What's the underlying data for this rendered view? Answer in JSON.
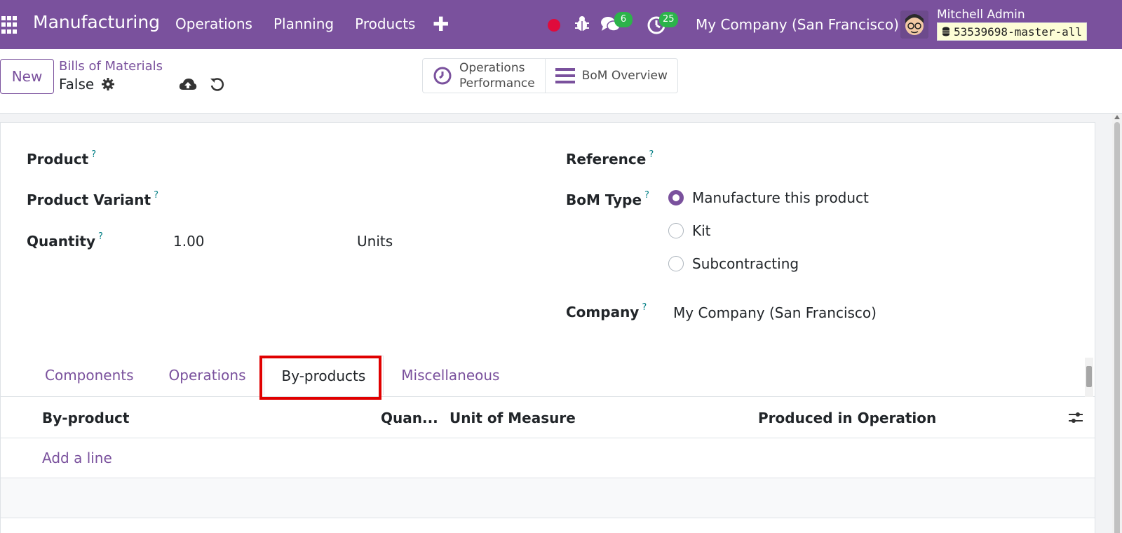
{
  "navbar": {
    "app_title": "Manufacturing",
    "menu": [
      "Operations",
      "Planning",
      "Products"
    ],
    "messages_count": "6",
    "activities_count": "25",
    "company": "My Company (San Francisco)",
    "user_name": "Mitchell Admin",
    "database": "53539698-master-all"
  },
  "control_panel": {
    "new_label": "New",
    "breadcrumb": "Bills of Materials",
    "record_name": "False",
    "smart_buttons": [
      {
        "line1": "Operations",
        "line2": "Performance",
        "icon": "clock-icon"
      },
      {
        "line1": "BoM Overview",
        "line2": "",
        "icon": "bars-icon"
      }
    ]
  },
  "form": {
    "product_label": "Product",
    "variant_label": "Product Variant",
    "quantity_label": "Quantity",
    "quantity_value": "1.00",
    "uom_value": "Units",
    "reference_label": "Reference",
    "bom_type_label": "BoM Type",
    "bom_type_options": [
      "Manufacture this product",
      "Kit",
      "Subcontracting"
    ],
    "bom_type_selected": "Manufacture this product",
    "company_label": "Company",
    "company_value": "My Company (San Francisco)",
    "help_mark": "?"
  },
  "tabs": [
    "Components",
    "Operations",
    "By-products",
    "Miscellaneous"
  ],
  "active_tab": "By-products",
  "table": {
    "columns": [
      "By-product",
      "Quan...",
      "Unit of Measure",
      "Produced in Operation"
    ],
    "add_line": "Add a line"
  },
  "colors": {
    "brand": "#7a519d",
    "badge": "#2cb34a",
    "highlight": "#e00000",
    "recording": "#e00b3c"
  }
}
